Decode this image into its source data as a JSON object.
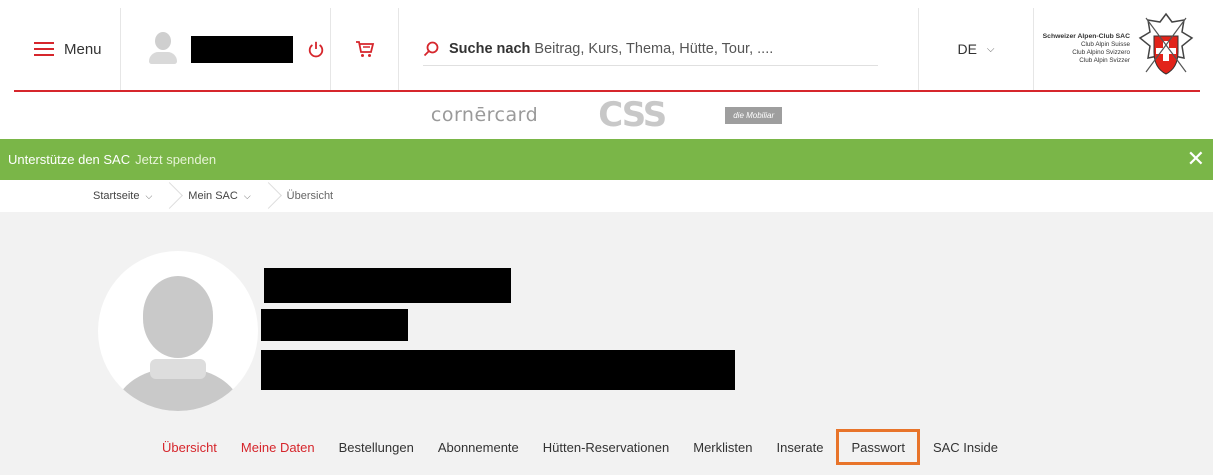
{
  "header": {
    "menu_label": "Menu",
    "search": {
      "bold": "Suche nach",
      "placeholder": "Beitrag, Kurs, Thema, Hütte, Tour, ...."
    },
    "language": "DE",
    "logo": {
      "title": "Schweizer Alpen-Club SAC",
      "lines": [
        "Club Alpin Suisse",
        "Club Alpino Svizzero",
        "Club Alpin Svizzer"
      ]
    },
    "accent_color": "#d6262c"
  },
  "sponsors": {
    "cornercard": "cornērcard",
    "css": "CSS",
    "mobiliar": "die Mobiliar"
  },
  "donate": {
    "text": "Unterstütze den SAC",
    "link": "Jetzt spenden",
    "bar_color": "#7ab648",
    "close": "✕"
  },
  "breadcrumb": {
    "items": [
      "Startseite",
      "Mein SAC",
      "Übersicht"
    ]
  },
  "tabs": {
    "items": [
      "Übersicht",
      "Meine Daten",
      "Bestellungen",
      "Abonnemente",
      "Hütten-Reservationen",
      "Merklisten",
      "Inserate",
      "Passwort",
      "SAC Inside"
    ],
    "highlight_color": "#e8742a"
  }
}
